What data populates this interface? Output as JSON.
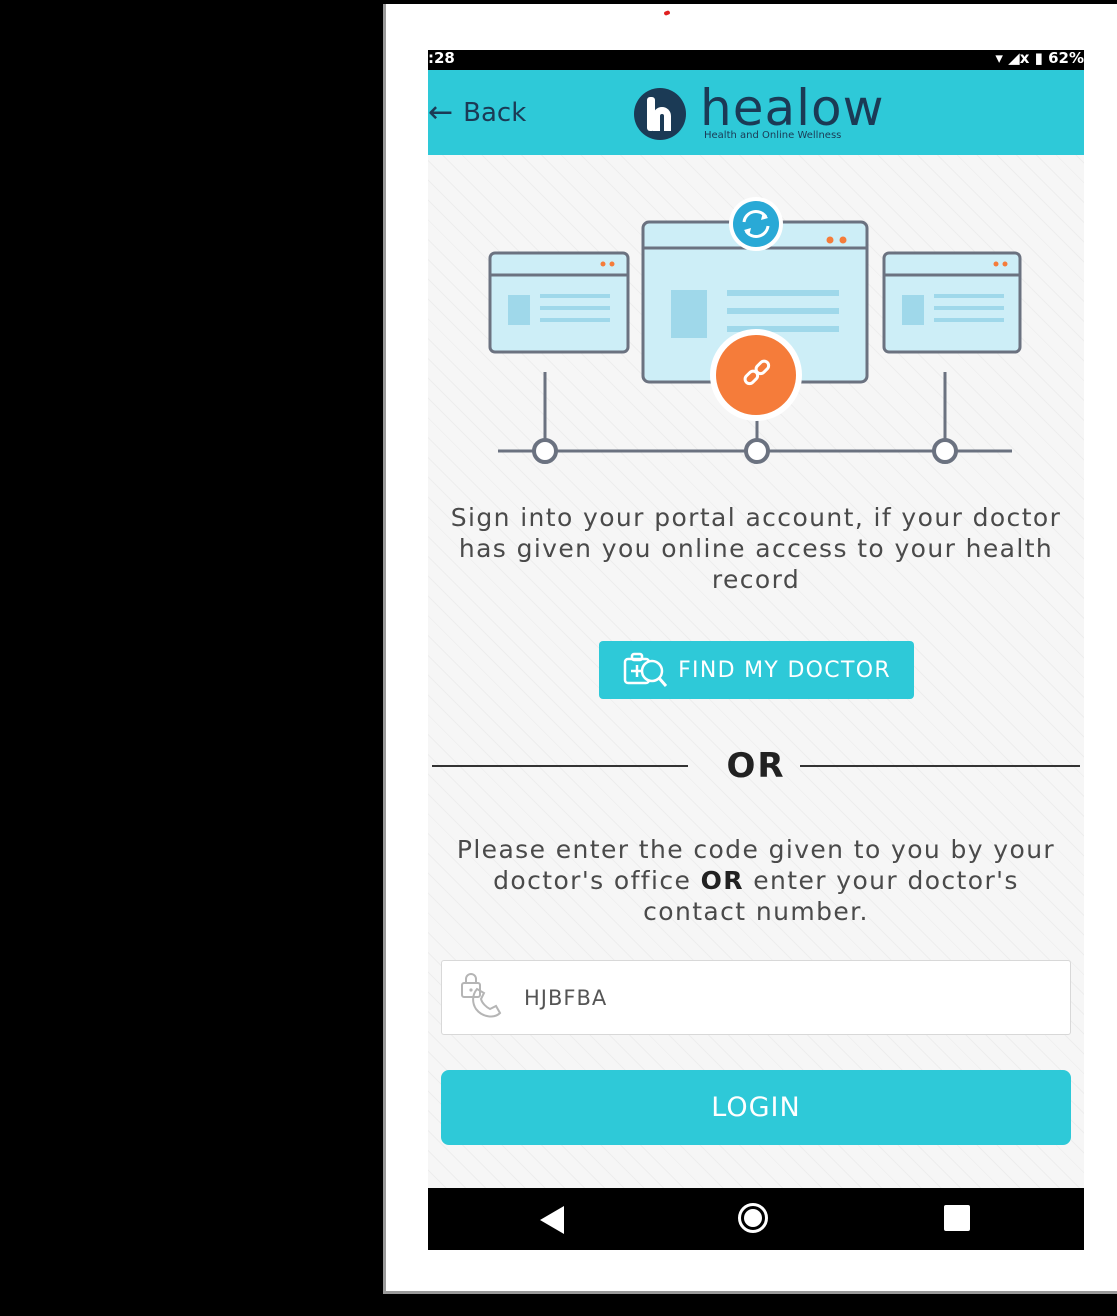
{
  "status_bar": {
    "time": ":28",
    "right": "▾ ◢x ▮ 62%"
  },
  "app_bar": {
    "back_label": "Back",
    "logo_name": "healow",
    "logo_tagline": "Health and Online Wellness"
  },
  "colors": {
    "accent": "#2ec9d8",
    "brand_dark": "#1b3a55",
    "link_orange": "#f57c3a"
  },
  "illustration": {
    "icons": [
      "sync-icon",
      "link-icon"
    ]
  },
  "intro_text": "Sign into your portal account, if your doctor has given you online access to your health record",
  "find_doctor": {
    "label": "FIND MY DOCTOR",
    "icon": "doctor-search-icon"
  },
  "divider_label": "OR",
  "code_text": {
    "part1": "Please enter the code given to you by your doctor's office ",
    "bold": "OR",
    "part2": " enter your doctor's contact number."
  },
  "code_field": {
    "value": "HJBFBA",
    "icon": "lock-phone-icon"
  },
  "login_label": "LOGIN",
  "nav_bar": {
    "icons": [
      "back-triangle-icon",
      "home-circle-icon",
      "recents-square-icon"
    ]
  }
}
